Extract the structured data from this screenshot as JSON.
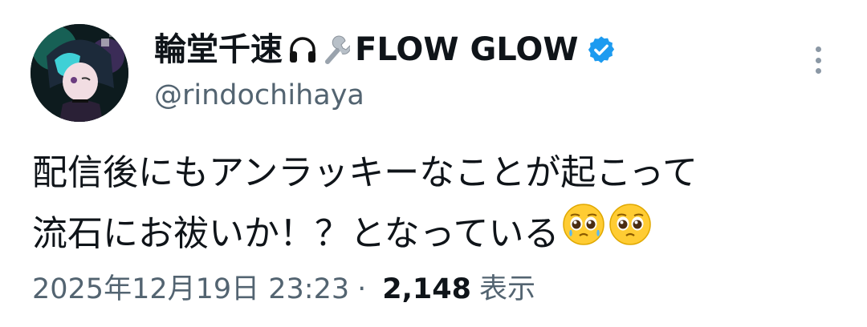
{
  "author": {
    "display_name": "輪堂千速",
    "display_name_suffix": "FLOW GLOW",
    "name_icons": [
      "headphones-icon",
      "wrench-icon"
    ],
    "handle": "@rindochihaya",
    "verified": true,
    "verified_color": "#1d9bf0"
  },
  "tweet": {
    "text_line1": "配信後にもアンラッキーなことが起こって",
    "text_line2": "流石にお祓いか！？となっている",
    "emojis": [
      "pleading-face-icon",
      "pleading-face-icon"
    ]
  },
  "meta": {
    "timestamp": "2025年12月19日 23:23",
    "separator": "·",
    "views_count": "2,148",
    "views_label": "表示"
  },
  "colors": {
    "text": "#0f1419",
    "secondary": "#536471",
    "accent": "#1d9bf0"
  }
}
